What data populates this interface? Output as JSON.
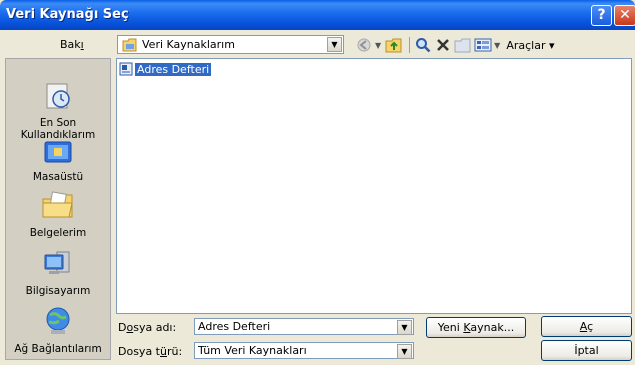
{
  "window": {
    "title": "Veri Kaynağı Seç",
    "help_label": "?",
    "close_label": "✕"
  },
  "lookin": {
    "label": "Bakı",
    "label_accel": "n",
    "value": "Veri Kaynaklarım"
  },
  "toolbar": {
    "icons": [
      "back-icon",
      "up-folder-icon",
      "search-web-icon",
      "delete-icon",
      "new-folder-icon",
      "views-icon"
    ],
    "tools_label": "Araçlar"
  },
  "places": [
    {
      "name": "recent",
      "label_line1": "En Son",
      "label_line2": "Kullandıklarım"
    },
    {
      "name": "desktop",
      "label_line1": "Masaüstü"
    },
    {
      "name": "documents",
      "label_line1": "Belgelerim"
    },
    {
      "name": "computer",
      "label_line1": "Bilgisayarım"
    },
    {
      "name": "network",
      "label_line1": "Ağ Bağlantılarım"
    }
  ],
  "files": [
    {
      "name": "Adres Defteri"
    }
  ],
  "filename": {
    "label": "Dosya adı:",
    "value": "Adres Defteri"
  },
  "filetype": {
    "label": "Dosya türü:",
    "value": "Tüm Veri Kaynakları"
  },
  "buttons": {
    "new_source": "Yeni Kaynak...",
    "open": "Aç",
    "cancel": "İptal"
  },
  "colors": {
    "title_blue": "#0854DD",
    "selection": "#316AC5",
    "dialog_bg": "#ECE9D8"
  }
}
